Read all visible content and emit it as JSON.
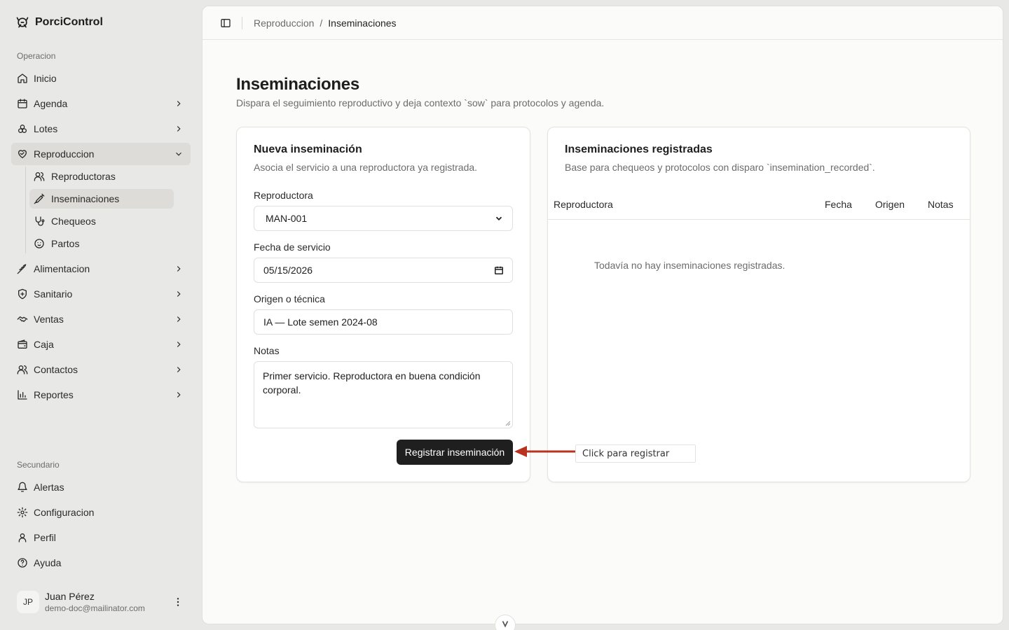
{
  "app": {
    "name": "PorciControl"
  },
  "sidebar": {
    "group_operacion": "Operacion",
    "items": [
      {
        "label": "Inicio"
      },
      {
        "label": "Agenda"
      },
      {
        "label": "Lotes"
      },
      {
        "label": "Reproduccion"
      },
      {
        "label": "Alimentacion"
      },
      {
        "label": "Sanitario"
      },
      {
        "label": "Ventas"
      },
      {
        "label": "Caja"
      },
      {
        "label": "Contactos"
      },
      {
        "label": "Reportes"
      }
    ],
    "subitems": [
      {
        "label": "Reproductoras"
      },
      {
        "label": "Inseminaciones"
      },
      {
        "label": "Chequeos"
      },
      {
        "label": "Partos"
      }
    ],
    "group_secundario": "Secundario",
    "secondary": [
      {
        "label": "Alertas"
      },
      {
        "label": "Configuracion"
      },
      {
        "label": "Perfil"
      },
      {
        "label": "Ayuda"
      }
    ],
    "user": {
      "initials": "JP",
      "name": "Juan Pérez",
      "email": "demo-doc@mailinator.com"
    }
  },
  "breadcrumb": {
    "parent": "Reproduccion",
    "separator": "/",
    "current": "Inseminaciones"
  },
  "page": {
    "title": "Inseminaciones",
    "subtitle": "Dispara el seguimiento reproductivo y deja contexto `sow` para protocolos y agenda."
  },
  "form": {
    "title": "Nueva inseminación",
    "subtitle": "Asocia el servicio a una reproductora ya registrada.",
    "reproductora_label": "Reproductora",
    "reproductora_value": "MAN-001",
    "fecha_label": "Fecha de servicio",
    "fecha_value": "05/15/2026",
    "origen_label": "Origen o técnica",
    "origen_value": "IA — Lote semen 2024-08",
    "notas_label": "Notas",
    "notas_value": "Primer servicio. Reproductora en buena condición corporal.",
    "submit_label": "Registrar inseminación"
  },
  "list": {
    "title": "Inseminaciones registradas",
    "subtitle": "Base para chequeos y protocolos con disparo `insemination_recorded`.",
    "columns": [
      "Reproductora",
      "Fecha",
      "Origen",
      "Notas"
    ],
    "empty_text": "Todavía no hay inseminaciones registradas."
  },
  "annotation": {
    "callout_text": "Click para registrar",
    "arrow_color": "#b8321f"
  }
}
